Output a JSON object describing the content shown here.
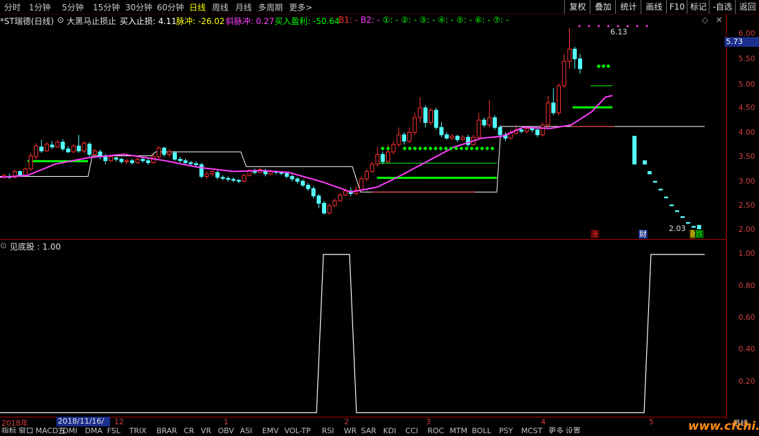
{
  "toolbar": {
    "periods": [
      "分时",
      "1分钟",
      "5分钟",
      "15分钟",
      "30分钟",
      "60分钟",
      "日线",
      "周线",
      "月线",
      "多周期",
      "更多>"
    ],
    "active_period": "日线",
    "right_buttons": [
      "复权",
      "叠加",
      "统计",
      "画线",
      "F10",
      "标记",
      "-自选",
      "返回"
    ]
  },
  "legend_top": {
    "stock": "*ST瑞德(日线)",
    "indicator_name": "大黑马止损止",
    "buy_stop_label": "买入止损: 4.11",
    "pulse_label": "脉冲: -26.02",
    "oblique_pulse_label": "斜脉冲: 0.27",
    "buy_profit_label": "买入盈利: -50.64",
    "b1_label": "B1: -",
    "b2_label": "B2: -",
    "circles": "①: - ②: - ③: - ④: - ⑤: - ⑥: - ⑦: -"
  },
  "price_axis": {
    "ticks": [
      "6.00",
      "5.50",
      "5.00",
      "4.50",
      "4.00",
      "3.50",
      "3.00",
      "2.50",
      "2.00"
    ],
    "current_price": "5.73",
    "high_label": "6.13",
    "low_label": "2.03"
  },
  "markers": {
    "zhang": "涨",
    "cai": "财",
    "rong": "融",
    "die": "跌"
  },
  "lower_panel": {
    "legend": "见底股 : 1.00",
    "ticks": [
      "1.00",
      "0.80",
      "0.60",
      "0.40",
      "0.20"
    ]
  },
  "x_axis": {
    "labels": [
      "2018年",
      "12",
      "1",
      "2",
      "3",
      "4",
      "5"
    ],
    "cursor_date": "2018/11/16/五",
    "period_label": "日线"
  },
  "bottom_tabs": [
    "指标",
    "窗口",
    "MACD",
    "DMI",
    "DMA",
    "FSL",
    "TRIX",
    "BRAR",
    "CR",
    "VR",
    "OBV",
    "ASI",
    "EMV",
    "VOL-TP",
    "RSI",
    "WR",
    "SAR",
    "KDJ",
    "CCI",
    "ROC",
    "MTM",
    "BOLL",
    "PSY",
    "MCST",
    "更多",
    "设置"
  ],
  "watermark": "www.cfchi.com",
  "colors": {
    "up": "#ff3232",
    "down": "#54ffff",
    "stop_line": "#ffffff",
    "green_bar": "#00ff00",
    "ma_line": "#ff40ff",
    "axis": "#b00000"
  }
}
